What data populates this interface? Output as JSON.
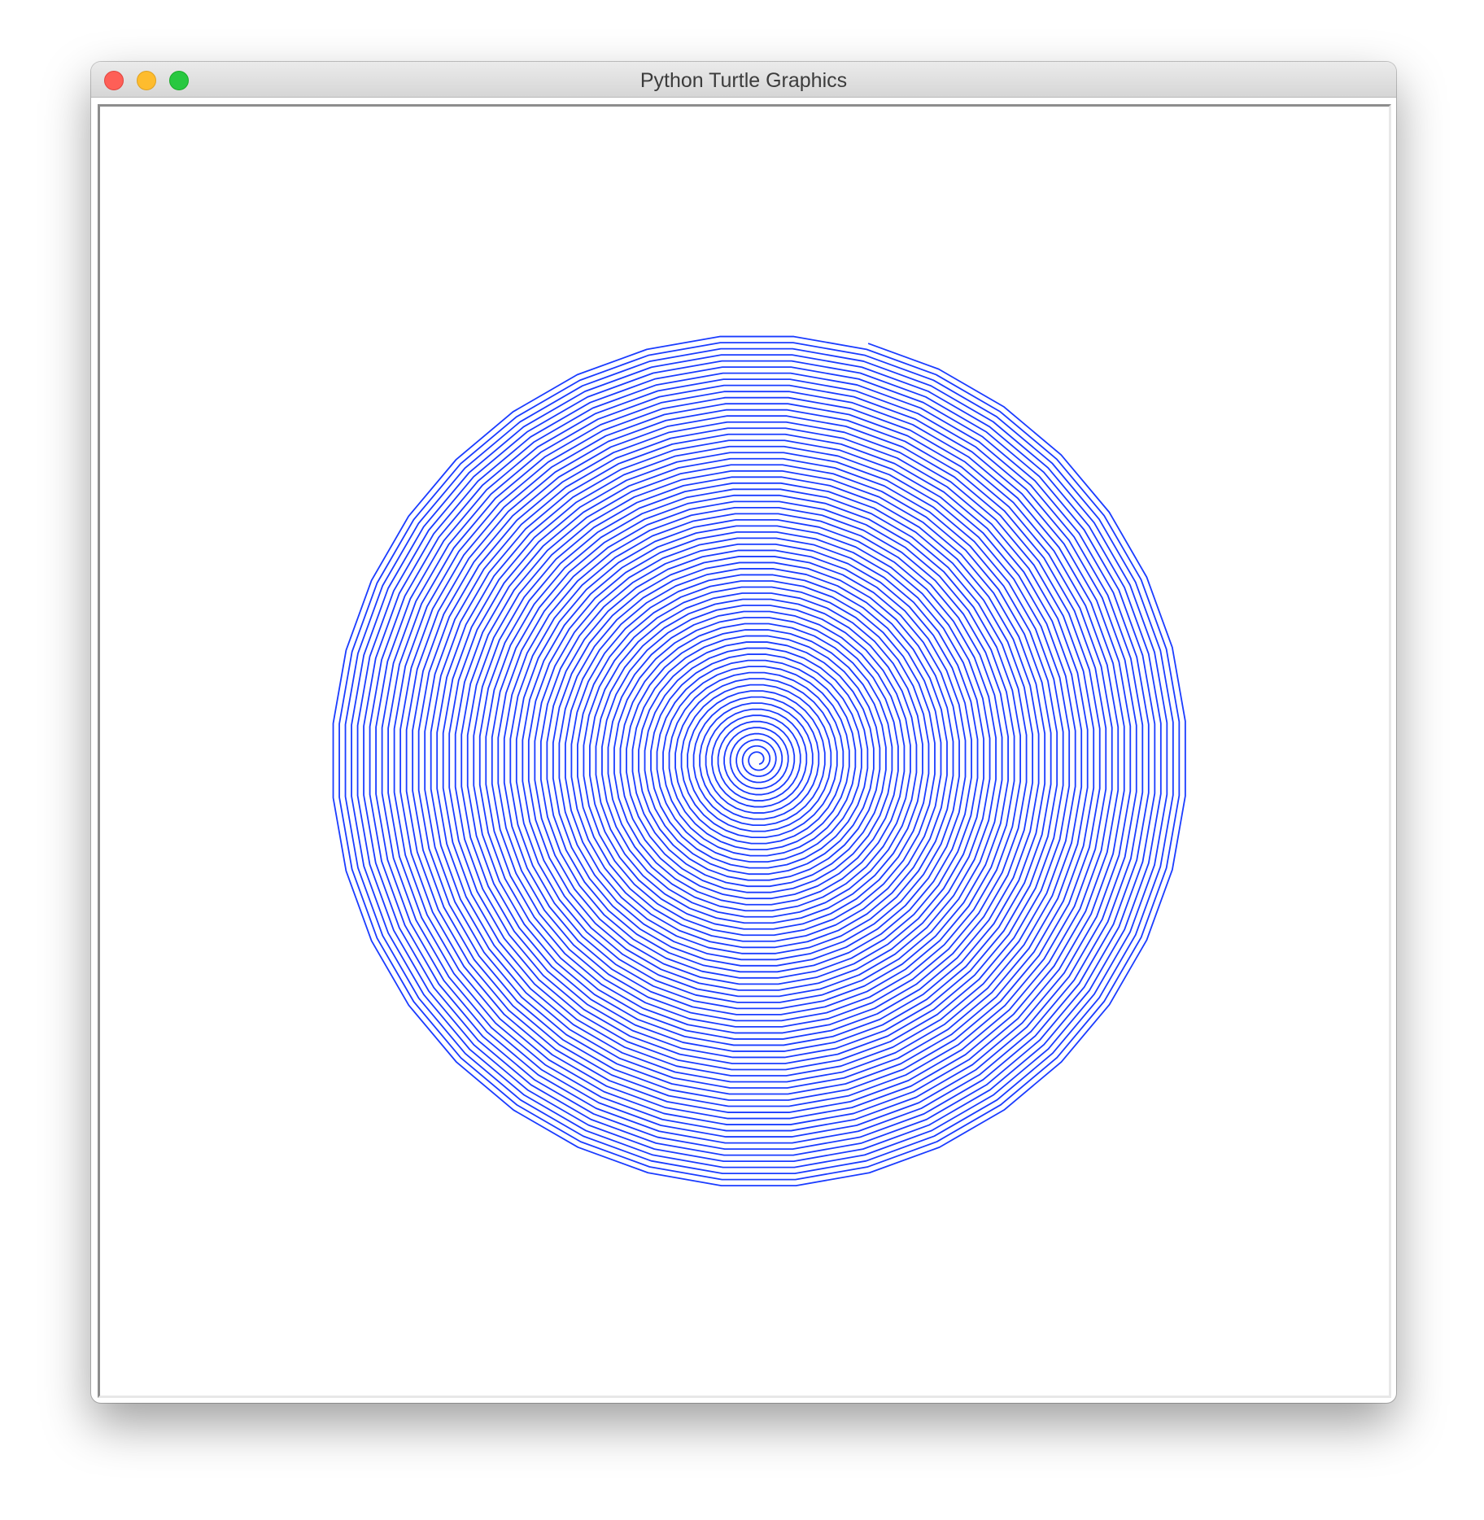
{
  "window": {
    "title": "Python Turtle Graphics"
  },
  "canvas": {
    "background": "#ffffff",
    "pen_color": "#1a3cff",
    "drawing": "spiral"
  },
  "icons": {
    "close": "close-button-icon",
    "minimize": "minimize-button-icon",
    "maximize": "zoom-button-icon"
  },
  "colors": {
    "close": "#fe5f57",
    "minimize": "#febc2e",
    "maximize": "#28c840"
  }
}
